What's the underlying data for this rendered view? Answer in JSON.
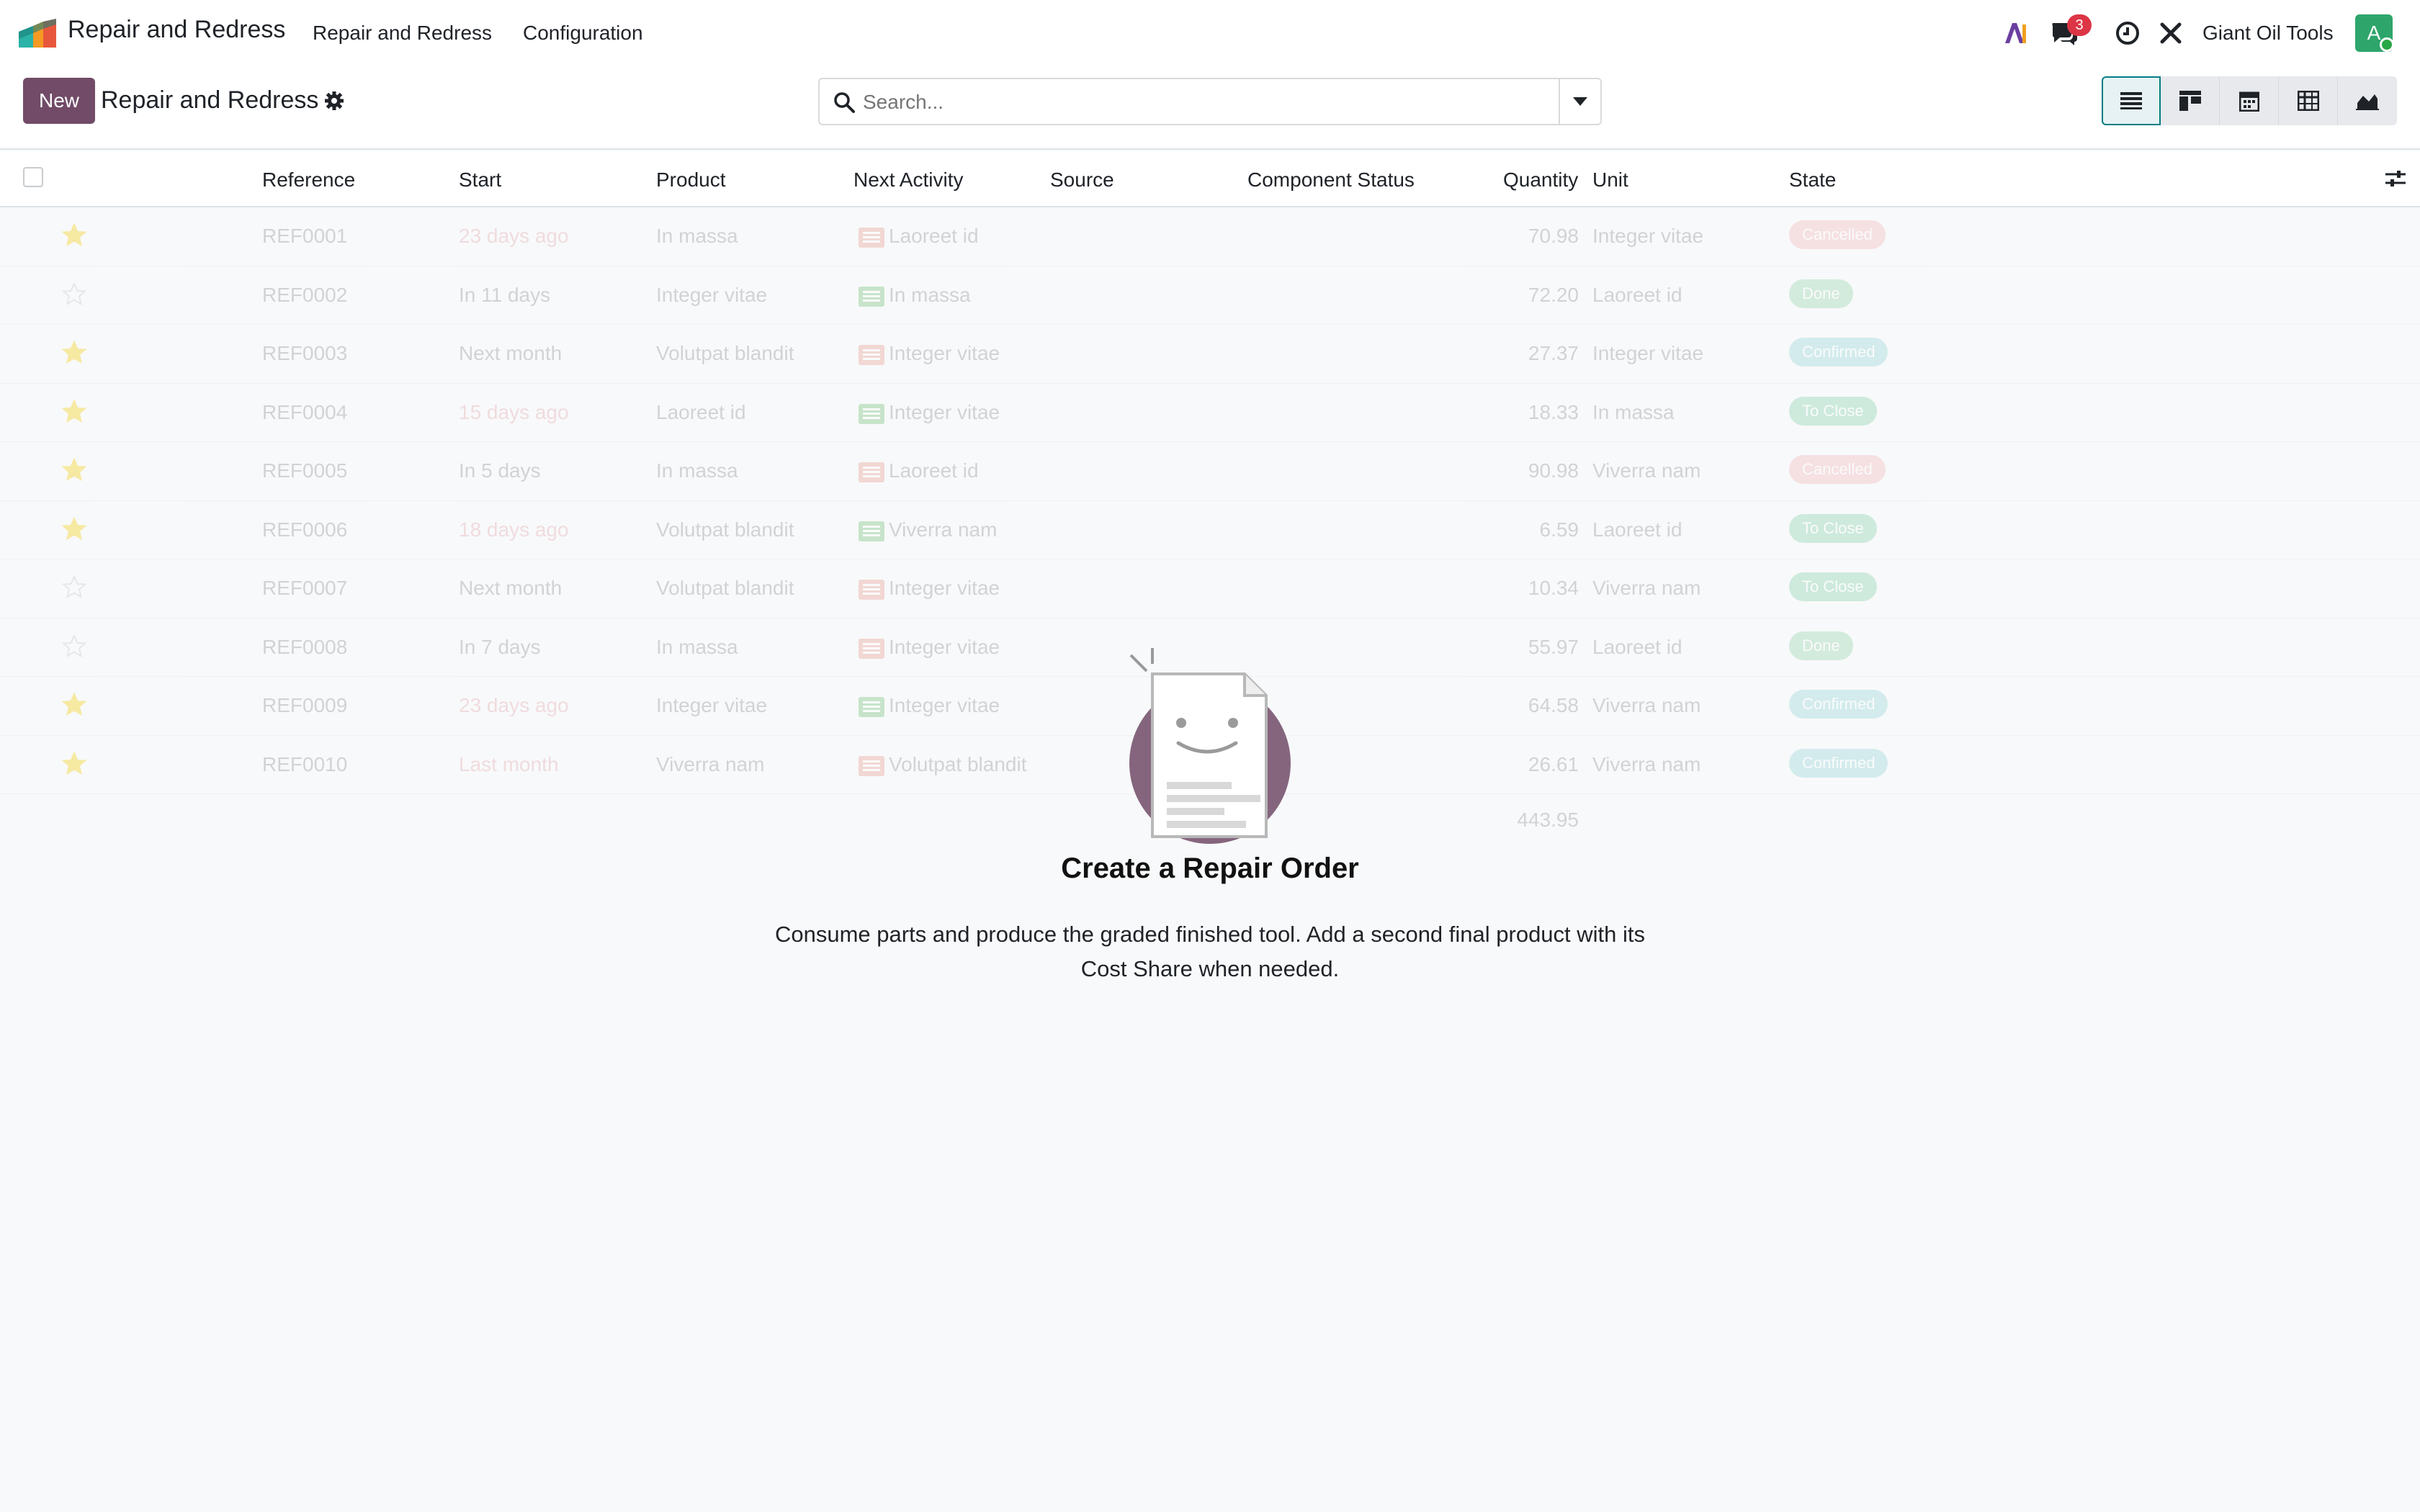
{
  "app": {
    "brand": "Repair and Redress",
    "menu": [
      "Repair and Redress",
      "Configuration"
    ],
    "company": "Giant Oil Tools",
    "avatar_letter": "A",
    "message_count": "3"
  },
  "control_panel": {
    "new_label": "New",
    "title": "Repair and Redress",
    "search_placeholder": "Search..."
  },
  "columns": [
    "Reference",
    "Start",
    "Product",
    "Next Activity",
    "Source",
    "Component Status",
    "Quantity",
    "Unit",
    "State"
  ],
  "rows": [
    {
      "ref": "REF0001",
      "start": "23 days ago",
      "start_overdue": true,
      "product": "In massa",
      "activity": "Laoreet id",
      "act_color": "#e8998f",
      "qty": "70.98",
      "unit": "Integer vitae",
      "state": "Cancelled",
      "state_color": "#f0b2b7",
      "starred": true
    },
    {
      "ref": "REF0002",
      "start": "In 11 days",
      "start_overdue": false,
      "product": "Integer vitae",
      "activity": "In massa",
      "act_color": "#6fbf73",
      "qty": "72.20",
      "unit": "Laoreet id",
      "state": "Done",
      "state_color": "#8fd3a6",
      "starred": false
    },
    {
      "ref": "REF0003",
      "start": "Next month",
      "start_overdue": false,
      "product": "Volutpat blandit",
      "activity": "Integer vitae",
      "act_color": "#e8998f",
      "qty": "27.37",
      "unit": "Integer vitae",
      "state": "Confirmed",
      "state_color": "#8fd3d6",
      "starred": true
    },
    {
      "ref": "REF0004",
      "start": "15 days ago",
      "start_overdue": true,
      "product": "Laoreet id",
      "activity": "Integer vitae",
      "act_color": "#6fbf73",
      "qty": "18.33",
      "unit": "In massa",
      "state": "To Close",
      "state_color": "#7fcfa8",
      "starred": true
    },
    {
      "ref": "REF0005",
      "start": "In 5 days",
      "start_overdue": false,
      "product": "In massa",
      "activity": "Laoreet id",
      "act_color": "#e8998f",
      "qty": "90.98",
      "unit": "Viverra nam",
      "state": "Cancelled",
      "state_color": "#f0b2b7",
      "starred": true
    },
    {
      "ref": "REF0006",
      "start": "18 days ago",
      "start_overdue": true,
      "product": "Volutpat blandit",
      "activity": "Viverra nam",
      "act_color": "#6fbf73",
      "qty": "6.59",
      "unit": "Laoreet id",
      "state": "To Close",
      "state_color": "#7fcfa8",
      "starred": true
    },
    {
      "ref": "REF0007",
      "start": "Next month",
      "start_overdue": false,
      "product": "Volutpat blandit",
      "activity": "Integer vitae",
      "act_color": "#e8998f",
      "qty": "10.34",
      "unit": "Viverra nam",
      "state": "To Close",
      "state_color": "#7fcfa8",
      "starred": false
    },
    {
      "ref": "REF0008",
      "start": "In 7 days",
      "start_overdue": false,
      "product": "In massa",
      "activity": "Integer vitae",
      "act_color": "#e8998f",
      "qty": "55.97",
      "unit": "Laoreet id",
      "state": "Done",
      "state_color": "#8fd3a6",
      "starred": false
    },
    {
      "ref": "REF0009",
      "start": "23 days ago",
      "start_overdue": true,
      "product": "Integer vitae",
      "activity": "Integer vitae",
      "act_color": "#6fbf73",
      "qty": "64.58",
      "unit": "Viverra nam",
      "state": "Confirmed",
      "state_color": "#8fd3d6",
      "starred": true
    },
    {
      "ref": "REF0010",
      "start": "Last month",
      "start_overdue": true,
      "product": "Viverra nam",
      "activity": "Volutpat blandit",
      "act_color": "#e8998f",
      "qty": "26.61",
      "unit": "Viverra nam",
      "state": "Confirmed",
      "state_color": "#8fd3d6",
      "starred": true
    }
  ],
  "total_qty": "443.95",
  "help": {
    "title": "Create a Repair Order",
    "body": "Consume parts and produce the graded finished tool. Add a second final product with its Cost Share when needed."
  },
  "colors": {
    "primary": "#714b67",
    "accent": "#017e84",
    "star": "#f3cc00",
    "badge": "#dc3545"
  },
  "icons": {
    "view_switch": [
      "list-view-icon",
      "kanban-view-icon",
      "calendar-view-icon",
      "pivot-view-icon",
      "graph-view-icon"
    ]
  }
}
